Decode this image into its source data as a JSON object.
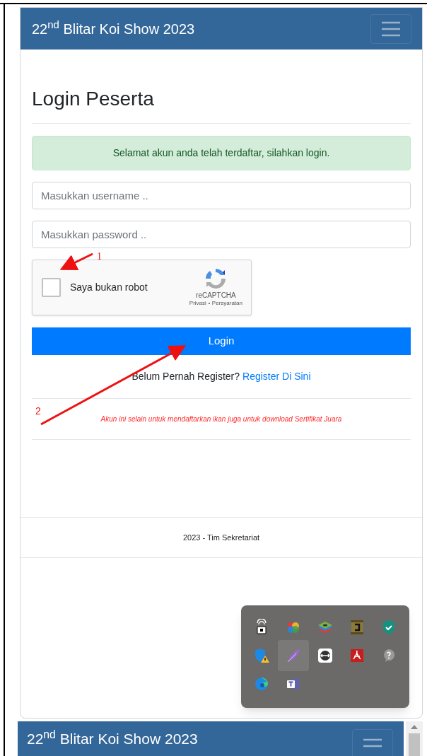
{
  "navbar": {
    "brand": "22$^{nd}$ Blitar Koi Show 2023"
  },
  "heading": "Login Peserta",
  "alert": "Selamat akun anda telah terdaftar, silahkan login.",
  "fields": [
    {
      "placeholder": "Masukkan username .."
    },
    {
      "placeholder": "Masukkan password .."
    }
  ],
  "recaptcha": {
    "label": "Saya bukan robot",
    "checked": false,
    "brand": "reCAPTCHA",
    "links": [
      "Privasi",
      "Persyaratan"
    ]
  },
  "login_button": "Login",
  "register": {
    "prompt": "Belum Pernah Register?",
    "link": "Register Di Sini"
  },
  "note": "Akun ini selain untuk mendaftarkan ikan juga untuk download Sertifikat Juara",
  "footer": "2023 - Tim Sekretariat",
  "annotations": [
    {
      "label": "1"
    },
    {
      "label": "2"
    }
  ],
  "tray": {
    "icons": [
      {
        "kind": "lock",
        "selected": false
      },
      {
        "kind": "colorwheel",
        "selected": false
      },
      {
        "kind": "layers",
        "selected": false
      },
      {
        "kind": "scroll",
        "selected": false
      },
      {
        "kind": "shield",
        "selected": false
      },
      {
        "kind": "shieldwarn",
        "selected": false
      },
      {
        "kind": "feather",
        "selected": true
      },
      {
        "kind": "remote",
        "selected": false
      },
      {
        "kind": "acrobat",
        "selected": false
      },
      {
        "kind": "help",
        "selected": false
      },
      {
        "kind": "edge",
        "selected": false
      },
      {
        "kind": "teams",
        "selected": false
      }
    ]
  },
  "bottom_navbar": {
    "brand": "22$^{nd}$ Blitar Koi Show 2023"
  }
}
